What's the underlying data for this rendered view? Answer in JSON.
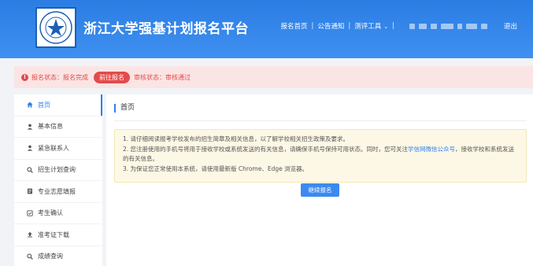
{
  "header": {
    "title": "浙江大学强基计划报名平台",
    "nav": {
      "home": "报名首页",
      "notice": "公告通知",
      "tools": "测评工具",
      "logout": "退出"
    }
  },
  "status": {
    "reg_text": "报名状态：报名完成",
    "button": "前往报名",
    "review_text": "审核状态：审核通过"
  },
  "sidebar": {
    "items": [
      {
        "label": "首页",
        "icon": "home-icon"
      },
      {
        "label": "基本信息",
        "icon": "user-icon"
      },
      {
        "label": "紧急联系人",
        "icon": "user-icon"
      },
      {
        "label": "招生计划查询",
        "icon": "search-icon"
      },
      {
        "label": "专业志愿填报",
        "icon": "form-icon"
      },
      {
        "label": "考生确认",
        "icon": "check-icon"
      },
      {
        "label": "准考证下载",
        "icon": "upload-icon"
      },
      {
        "label": "成绩查询",
        "icon": "search-icon"
      }
    ]
  },
  "main": {
    "title": "首页",
    "notice": {
      "line1": "1. 请仔细阅读报考学校发布的招生简章及相关信息，以了解学校相关招生政策及要求。",
      "line2_a": "2. 您注册使用的手机号将用于接收学校或系统发送的有关信息，请确保手机号保持可用状态。同时，您可关注",
      "line2_link": "学信网微信公众号",
      "line2_b": "，接收学校和系统发送的有关信息。",
      "line3": "3. 为保证您正常使用本系统，请使用最新版 Chrome、Edge 浏览器。"
    },
    "continue_button": "继续报名"
  },
  "colors": {
    "brand_blue": "#2f80ed",
    "status_red": "#e24b4b",
    "notice_bg": "#fdf8e6"
  }
}
